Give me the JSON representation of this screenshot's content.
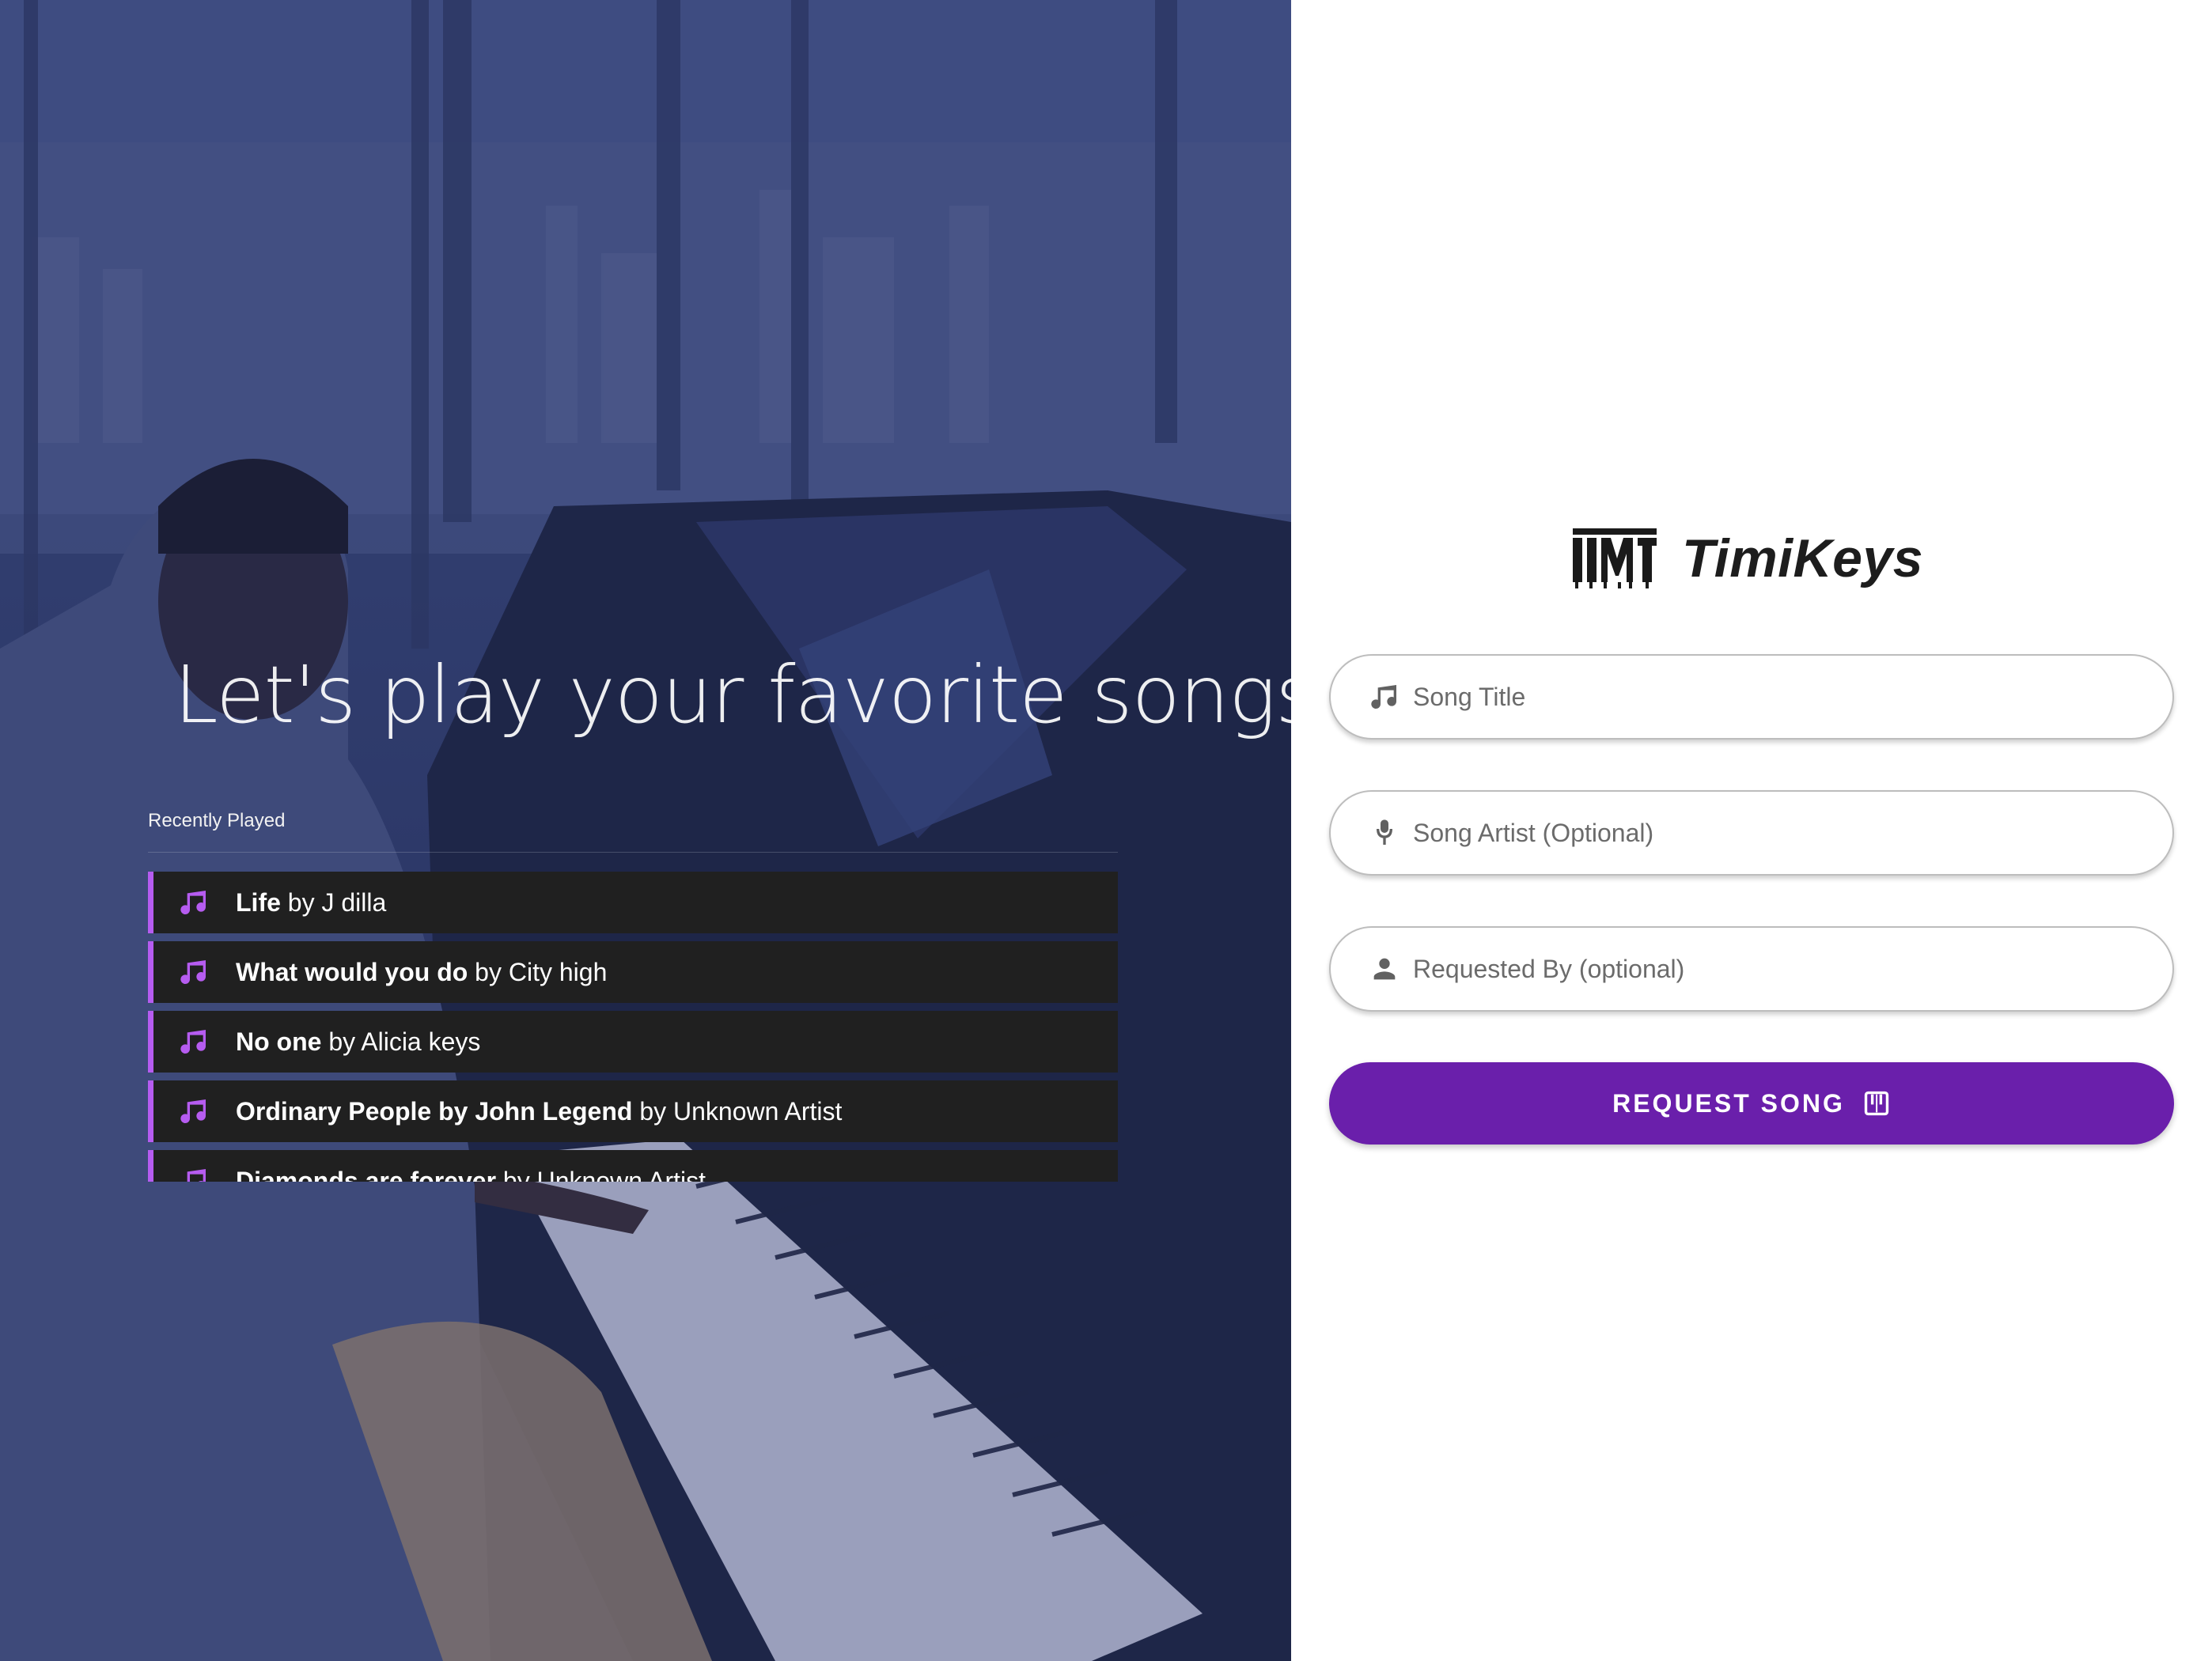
{
  "hero": {
    "headline": "Let's play your favorite songs",
    "recent_label": "Recently Played",
    "recent": [
      {
        "title": "Life",
        "sep": " by ",
        "artist": "J dilla"
      },
      {
        "title": "What would you do",
        "sep": " by ",
        "artist": "City high"
      },
      {
        "title": "No one",
        "sep": " by ",
        "artist": "Alicia keys"
      },
      {
        "title": "Ordinary People by John Legend",
        "sep": " by ",
        "artist": "Unknown Artist"
      },
      {
        "title": "Diamonds are forever",
        "sep": " by ",
        "artist": "Unknown Artist"
      }
    ]
  },
  "brand": {
    "name": "TimiKeys",
    "logo_icon": "piano-keys-logo"
  },
  "form": {
    "song_title": {
      "placeholder": "Song Title",
      "value": "",
      "icon": "music-note-icon"
    },
    "song_artist": {
      "placeholder": "Song Artist (Optional)",
      "value": "",
      "icon": "microphone-icon"
    },
    "requested_by": {
      "placeholder": "Requested By (optional)",
      "value": "",
      "icon": "person-icon"
    },
    "submit_label": "REQUEST SONG",
    "submit_icon": "piano-icon"
  },
  "colors": {
    "accent": "#6a1fab",
    "list_accent": "#b65cf0",
    "list_bg": "#202020"
  }
}
